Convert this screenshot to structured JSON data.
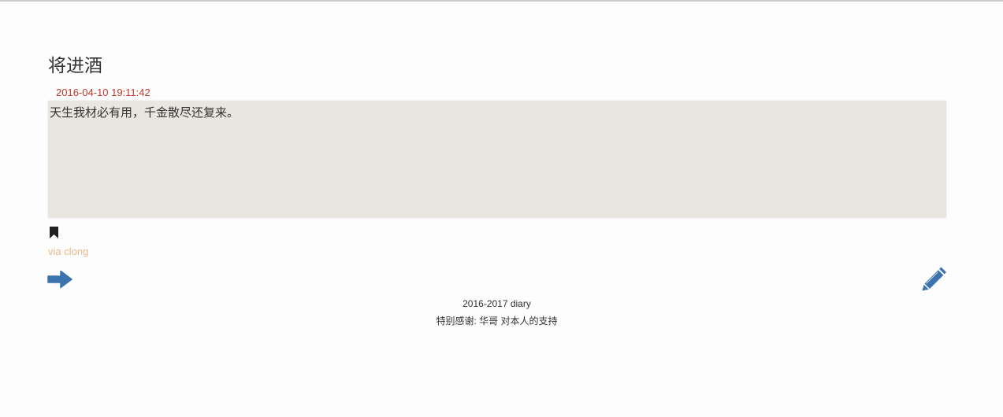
{
  "post": {
    "title": "将进酒",
    "date": "2016-04-10 19:11:42",
    "content": "天生我材必有用，千金散尽还复来。",
    "via": "via clong"
  },
  "icons": {
    "bookmark": "bookmark-icon",
    "next": "arrow-right-icon",
    "edit": "pencil-icon"
  },
  "colors": {
    "date": "#c0392b",
    "via": "#e8b98b",
    "link_icon": "#3a73ad",
    "content_background": "#e9e6df"
  },
  "footer": {
    "line1": "2016-2017 diary",
    "line2": "特别感谢: 华哥 对本人的支持"
  }
}
